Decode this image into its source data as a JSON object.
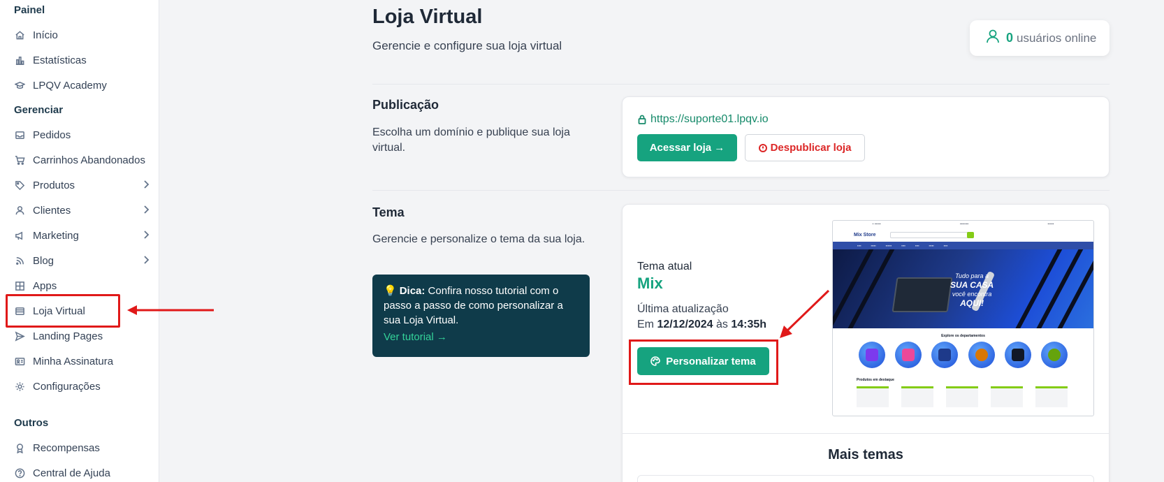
{
  "sidebar": {
    "sections": [
      {
        "title": "Painel"
      },
      {
        "title": "Gerenciar"
      },
      {
        "title": "Outros"
      }
    ],
    "items": [
      {
        "label": "Início",
        "icon": "home-icon"
      },
      {
        "label": "Estatísticas",
        "icon": "bar-chart-icon"
      },
      {
        "label": "LPQV Academy",
        "icon": "graduation-cap-icon"
      },
      {
        "label": "Pedidos",
        "icon": "inbox-icon"
      },
      {
        "label": "Carrinhos Abandonados",
        "icon": "cart-icon"
      },
      {
        "label": "Produtos",
        "icon": "tag-icon",
        "has_submenu": true
      },
      {
        "label": "Clientes",
        "icon": "user-icon",
        "has_submenu": true
      },
      {
        "label": "Marketing",
        "icon": "megaphone-icon",
        "has_submenu": true
      },
      {
        "label": "Blog",
        "icon": "rss-icon",
        "has_submenu": true
      },
      {
        "label": "Apps",
        "icon": "grid-icon"
      },
      {
        "label": "Loja Virtual",
        "icon": "store-icon",
        "active": true
      },
      {
        "label": "Landing Pages",
        "icon": "send-icon"
      },
      {
        "label": "Minha Assinatura",
        "icon": "id-card-icon"
      },
      {
        "label": "Configurações",
        "icon": "gear-icon"
      },
      {
        "label": "Recompensas",
        "icon": "award-icon"
      },
      {
        "label": "Central de Ajuda",
        "icon": "help-circle-icon"
      }
    ]
  },
  "header": {
    "title": "Loja Virtual",
    "subtitle": "Gerencie e configure sua loja virtual",
    "online": {
      "count": "0",
      "label": "usuários online"
    }
  },
  "publicacao": {
    "title": "Publicação",
    "description": "Escolha um domínio e publique sua loja virtual.",
    "url": "https://suporte01.lpqv.io",
    "access_button": "Acessar loja →",
    "unpublish_button": "Despublicar loja"
  },
  "tema": {
    "title": "Tema",
    "description": "Gerencie e personalize o tema da sua loja.",
    "tip_label": "Dica:",
    "tip_text": "Confira nosso tutorial com o passo a passo de como personalizar a sua Loja Virtual.",
    "tip_link": "Ver tutorial →",
    "current_label": "Tema atual",
    "current_name": "Mix",
    "updated_label": "Última atualização",
    "updated_prefix": "Em",
    "updated_date": "12/12/2024",
    "updated_mid": "às",
    "updated_time": "14:35h",
    "customize_button": "Personalizar tema",
    "more_themes": "Mais temas"
  },
  "preview": {
    "logo": "Mix Store",
    "banner_line1": "Tudo para a",
    "banner_line2": "SUA CASA",
    "banner_line3": "você encontra",
    "banner_line4": "AQUI!",
    "departments_title": "Explore os departamentos",
    "featured_title": "Produtos em destaque"
  },
  "colors": {
    "brand_green": "#16a37f",
    "tip_bg": "#0f3b4a",
    "danger": "#dc2626",
    "annotation_red": "#e01919"
  }
}
